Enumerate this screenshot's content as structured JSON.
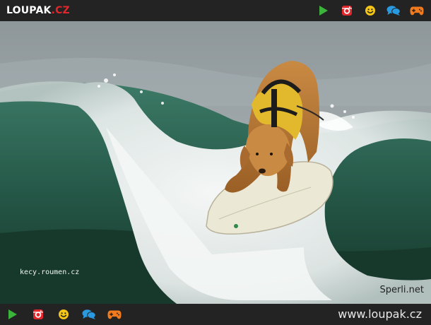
{
  "header": {
    "logo_main": "LOUPAK",
    "logo_tld": ".CZ",
    "icons": [
      "play-icon",
      "instagram-icon",
      "smiley-icon",
      "chat-bubbles-icon",
      "gamepad-icon"
    ]
  },
  "photo": {
    "watermark_left": "kecy.roumen.cz",
    "watermark_right": "Sperli.net"
  },
  "footer": {
    "icons": [
      "play-icon",
      "instagram-icon",
      "smiley-icon",
      "chat-bubbles-icon",
      "gamepad-icon"
    ],
    "site_url": "www.loupak.cz"
  },
  "colors": {
    "bar_bg": "#232323",
    "play": "#3cb43c",
    "instagram": "#e2262b",
    "smiley": "#f5c518",
    "chat": "#2a9ae0",
    "gamepad": "#f07a1e",
    "logo_tld": "#e2262b"
  }
}
